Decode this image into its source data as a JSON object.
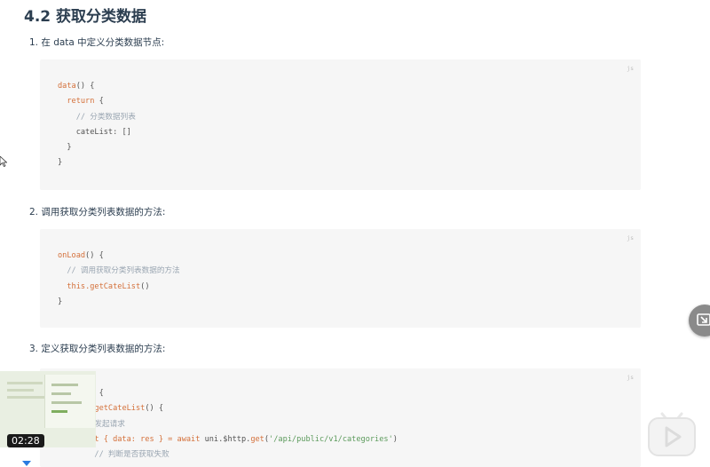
{
  "heading": "4.2 获取分类数据",
  "steps": [
    {
      "label": "1. 在 data 中定义分类数据节点:"
    },
    {
      "label": "2. 调用获取分类列表数据的方法:"
    },
    {
      "label": "3. 定义获取分类列表数据的方法:"
    }
  ],
  "code_lang": "js",
  "block1": {
    "l1a": "data",
    "l1b": "() {",
    "l2": "return",
    "l2b": " {",
    "l3": "// 分类数据列表",
    "l4": "cateList: []",
    "l5": "}",
    "l6": "}"
  },
  "block2": {
    "l1a": "onLoad",
    "l1b": "() {",
    "l2": "// 调用获取分类列表数据的方法",
    "l3a": "this",
    "l3b": ".getCateList",
    "l3c": "()",
    "l4": "}"
  },
  "block3": {
    "l1": "{",
    "l2a": "getCateList",
    "l2b": "() {",
    "l3": "发起请求",
    "l4a": "it { data: res } = ",
    "l4b": "await",
    "l4c": " uni.$http.",
    "l4d": "get",
    "l4e": "(",
    "l4f": "'/api/public/v1/categories'",
    "l4g": ")",
    "l5": "// 判断是否获取失败"
  },
  "video": {
    "time": "02:28"
  },
  "icons": {
    "cursor": "mouse-cursor-icon",
    "float": "scroll-to-icon",
    "play": "play-icon"
  },
  "colors": {
    "keyword": "#d4703a",
    "comment": "#9aa6b2",
    "string": "#5b9a5b",
    "heading": "#2c3e50"
  }
}
